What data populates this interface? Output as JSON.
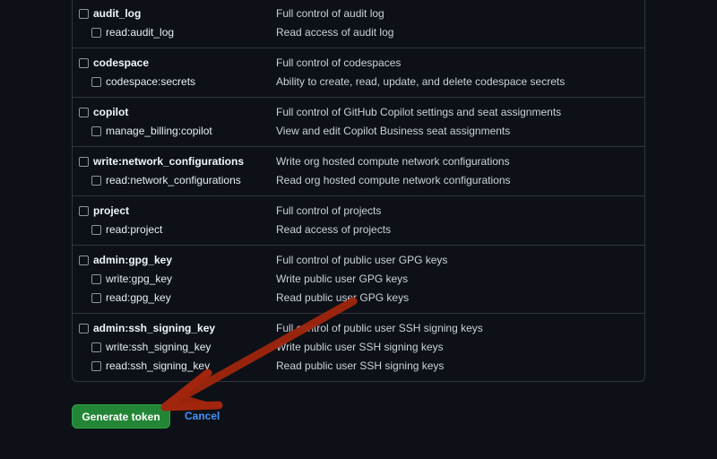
{
  "scope_groups": [
    {
      "parent": {
        "name": "audit_log",
        "description": "Full control of audit log"
      },
      "children": [
        {
          "name": "read:audit_log",
          "description": "Read access of audit log"
        }
      ]
    },
    {
      "parent": {
        "name": "codespace",
        "description": "Full control of codespaces"
      },
      "children": [
        {
          "name": "codespace:secrets",
          "description": "Ability to create, read, update, and delete codespace secrets"
        }
      ]
    },
    {
      "parent": {
        "name": "copilot",
        "description": "Full control of GitHub Copilot settings and seat assignments"
      },
      "children": [
        {
          "name": "manage_billing:copilot",
          "description": "View and edit Copilot Business seat assignments"
        }
      ]
    },
    {
      "parent": {
        "name": "write:network_configurations",
        "description": "Write org hosted compute network configurations"
      },
      "children": [
        {
          "name": "read:network_configurations",
          "description": "Read org hosted compute network configurations"
        }
      ]
    },
    {
      "parent": {
        "name": "project",
        "description": "Full control of projects"
      },
      "children": [
        {
          "name": "read:project",
          "description": "Read access of projects"
        }
      ]
    },
    {
      "parent": {
        "name": "admin:gpg_key",
        "description": "Full control of public user GPG keys"
      },
      "children": [
        {
          "name": "write:gpg_key",
          "description": "Write public user GPG keys"
        },
        {
          "name": "read:gpg_key",
          "description": "Read public user GPG keys"
        }
      ]
    },
    {
      "parent": {
        "name": "admin:ssh_signing_key",
        "description": "Full control of public user SSH signing keys"
      },
      "children": [
        {
          "name": "write:ssh_signing_key",
          "description": "Write public user SSH signing keys"
        },
        {
          "name": "read:ssh_signing_key",
          "description": "Read public user SSH signing keys"
        }
      ]
    }
  ],
  "footer": {
    "generate_label": "Generate token",
    "cancel_label": "Cancel"
  },
  "colors": {
    "background": "#0d1117",
    "border": "#30363d",
    "primary_button": "#238636",
    "link": "#4493f8",
    "annotation_arrow": "#a1260d"
  },
  "annotation": {
    "type": "arrow",
    "target": "generate-token-button"
  }
}
